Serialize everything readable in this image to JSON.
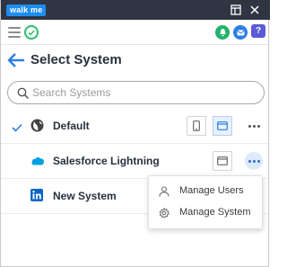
{
  "titlebar": {
    "logo": "walk me"
  },
  "toolbar": {
    "purple_badge": "?"
  },
  "header": {
    "title": "Select System"
  },
  "search": {
    "placeholder": "Search Systems",
    "value": ""
  },
  "systems": [
    {
      "label": "Default",
      "selected": true
    },
    {
      "label": "Salesforce Lightning",
      "selected": false
    },
    {
      "label": "New System",
      "selected": false
    }
  ],
  "menu": {
    "items": [
      {
        "label": "Manage Users"
      },
      {
        "label": "Manage System"
      }
    ]
  },
  "colors": {
    "titlebar": "#2f3542",
    "logo": "#1d8df0",
    "accent_blue": "#2b7fe3",
    "green": "#22b36b",
    "purple": "#5b5bd6",
    "salesforce": "#00a1e0",
    "linkedin": "#0a66c2"
  }
}
